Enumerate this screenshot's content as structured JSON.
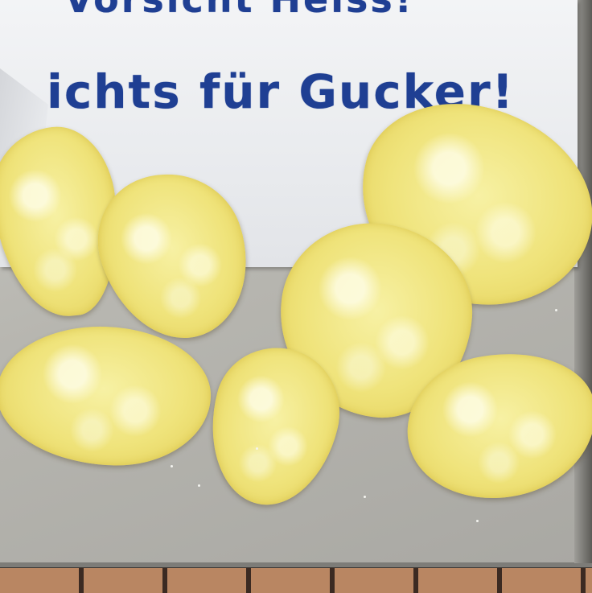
{
  "sign": {
    "line1": "Vorsicht Heiss!",
    "line2": "ichts für Gucker!",
    "text_color": "#1f3f93"
  },
  "colors": {
    "paper": "#eceef1",
    "tray": "#b7b6b0",
    "chip": "#f2e68a"
  },
  "objects": [
    "potato-chip",
    "potato-chip",
    "potato-chip",
    "potato-chip",
    "potato-chip",
    "potato-chip",
    "potato-chip"
  ]
}
